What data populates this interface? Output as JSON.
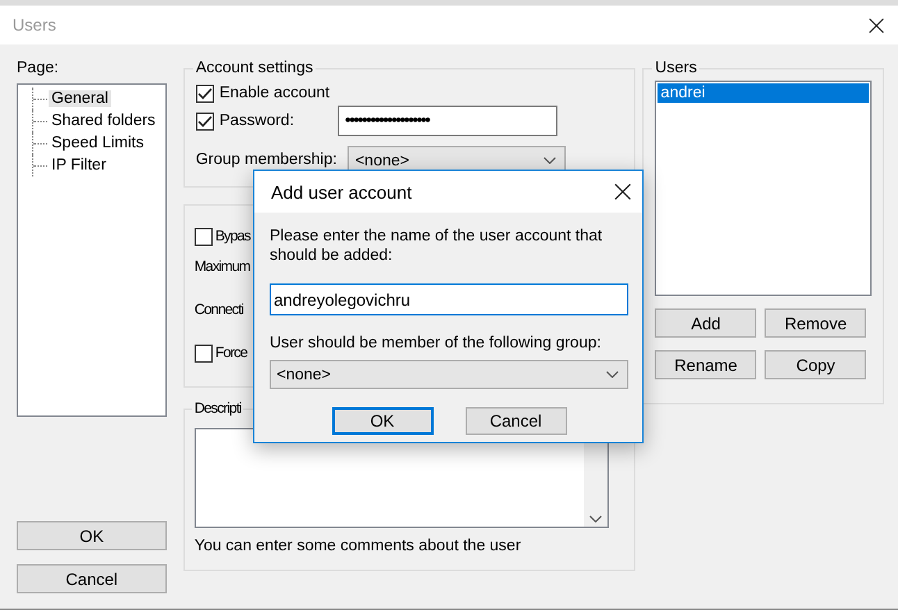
{
  "window": {
    "title": "Users"
  },
  "page_panel": {
    "label": "Page:",
    "items": [
      {
        "label": "General",
        "selected": true
      },
      {
        "label": "Shared folders",
        "selected": false
      },
      {
        "label": "Speed Limits",
        "selected": false
      },
      {
        "label": "IP Filter",
        "selected": false
      }
    ]
  },
  "account_settings": {
    "title": "Account settings",
    "enable_account": {
      "label": "Enable account",
      "checked": true
    },
    "password": {
      "label": "Password:",
      "checked": true,
      "value": "••••••••••••••••••••"
    },
    "group_membership": {
      "label": "Group membership:",
      "value": "<none>"
    }
  },
  "limits": {
    "bypass": {
      "label": "Bypas",
      "checked": false
    },
    "maximum_label": "Maximum",
    "connections_label": "Connecti",
    "force": {
      "label": "Force",
      "checked": false
    }
  },
  "description": {
    "title": "Descripti",
    "hint": "You can enter some comments about the user"
  },
  "users": {
    "title": "Users",
    "items": [
      {
        "label": "andrei",
        "selected": true
      }
    ],
    "buttons": [
      "Add",
      "Remove",
      "Rename",
      "Copy"
    ]
  },
  "footer_buttons": [
    "OK",
    "Cancel"
  ],
  "dialog": {
    "title": "Add user account",
    "prompt": "Please enter the name of the user account that should be added:",
    "name_value": "andreyolegovichru",
    "group_label": "User should be member of the following group:",
    "group_value": "<none>",
    "buttons": [
      {
        "label": "OK",
        "default": true
      },
      {
        "label": "Cancel",
        "default": false
      }
    ]
  }
}
